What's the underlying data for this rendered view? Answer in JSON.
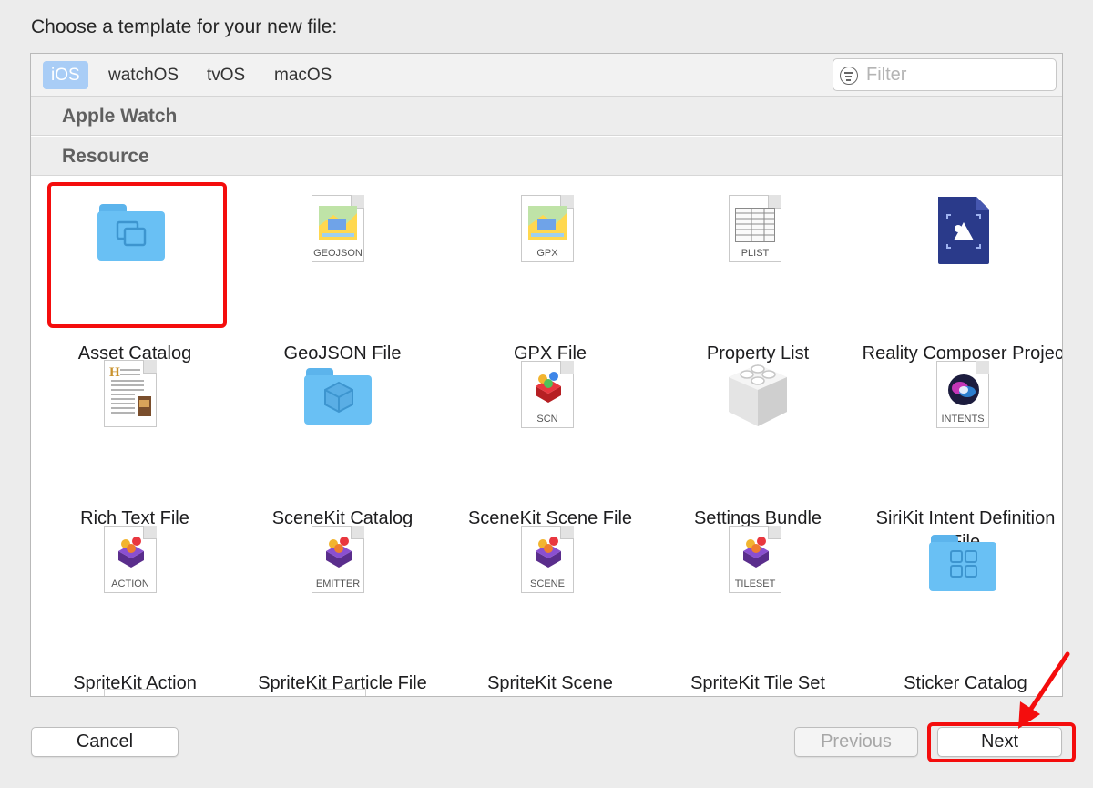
{
  "heading": "Choose a template for your new file:",
  "tabs": [
    "iOS",
    "watchOS",
    "tvOS",
    "macOS"
  ],
  "filter": {
    "placeholder": "Filter",
    "icon": "filter-icon"
  },
  "sections": [
    "Apple Watch",
    "Resource"
  ],
  "templates": [
    {
      "label": "Asset Catalog",
      "icon": "folder-icon"
    },
    {
      "label": "GeoJSON File",
      "icon": "document-icon",
      "badge": "GEOJSON"
    },
    {
      "label": "GPX File",
      "icon": "document-icon",
      "badge": "GPX"
    },
    {
      "label": "Property List",
      "icon": "document-icon",
      "badge": "PLIST"
    },
    {
      "label": "Reality Composer Project",
      "icon": "reality-composer-icon"
    },
    {
      "label": "Rich Text File",
      "icon": "rich-text-icon"
    },
    {
      "label": "SceneKit Catalog",
      "icon": "folder-icon"
    },
    {
      "label": "SceneKit Scene File",
      "icon": "document-icon",
      "badge": "SCN"
    },
    {
      "label": "Settings Bundle",
      "icon": "lego-brick-icon"
    },
    {
      "label": "SiriKit Intent Definition File",
      "icon": "document-icon",
      "badge": "INTENTS"
    },
    {
      "label": "SpriteKit Action",
      "icon": "document-icon",
      "badge": "ACTION"
    },
    {
      "label": "SpriteKit Particle File",
      "icon": "document-icon",
      "badge": "EMITTER"
    },
    {
      "label": "SpriteKit Scene",
      "icon": "document-icon",
      "badge": "SCENE"
    },
    {
      "label": "SpriteKit Tile Set",
      "icon": "document-icon",
      "badge": "TILESET"
    },
    {
      "label": "Sticker Catalog",
      "icon": "folder-icon"
    }
  ],
  "buttons": {
    "cancel": "Cancel",
    "previous": "Previous",
    "next": "Next"
  },
  "colors": {
    "selected_tab": "#a9cdf6",
    "highlight": "#f40d0d",
    "folder": "#69c0f4"
  }
}
